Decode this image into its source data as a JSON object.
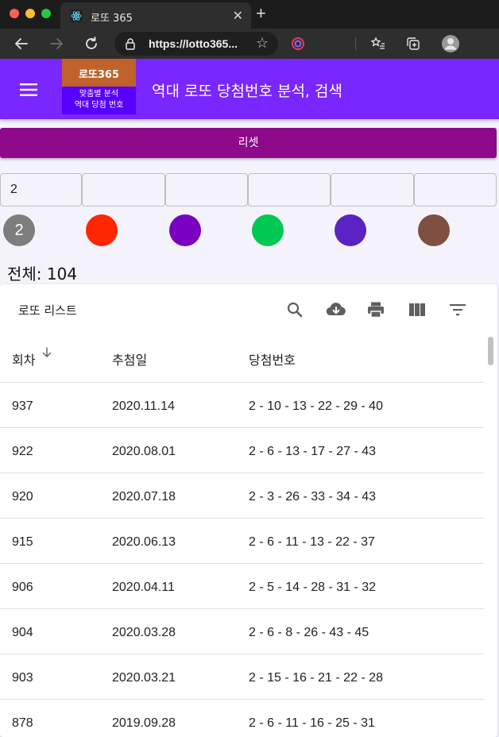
{
  "browser": {
    "tab_title": "로또 365",
    "url": "https://lotto365..."
  },
  "header": {
    "logo_top": "로또365",
    "logo_bottom_line1": "맞춤별 분석",
    "logo_bottom_line2": "역대 당첨 번호",
    "title": "역대 로또 당첨번호 분석, 검색"
  },
  "reset_label": "리셋",
  "inputs": [
    {
      "value": "2"
    },
    {
      "value": ""
    },
    {
      "value": ""
    },
    {
      "value": ""
    },
    {
      "value": ""
    },
    {
      "value": ""
    }
  ],
  "balls": [
    {
      "label": "2",
      "color": "#7d7d7d"
    },
    {
      "label": "",
      "color": "#ff2600"
    },
    {
      "label": "",
      "color": "#7a00c2"
    },
    {
      "label": "",
      "color": "#00c853"
    },
    {
      "label": "",
      "color": "#5a22c3"
    },
    {
      "label": "",
      "color": "#7f4f42"
    }
  ],
  "total_text": "전체: 104",
  "table": {
    "title": "로또 리스트",
    "columns": [
      "회차",
      "추첨일",
      "당첨번호"
    ],
    "icons": [
      "search-icon",
      "cloud-download-icon",
      "print-icon",
      "view-columns-icon",
      "filter-list-icon"
    ],
    "rows": [
      {
        "round": "937",
        "date": "2020.11.14",
        "numbers": "2 - 10 - 13 - 22 - 29 - 40"
      },
      {
        "round": "922",
        "date": "2020.08.01",
        "numbers": "2 - 6 - 13 - 17 - 27 - 43"
      },
      {
        "round": "920",
        "date": "2020.07.18",
        "numbers": "2 - 3 - 26 - 33 - 34 - 43"
      },
      {
        "round": "915",
        "date": "2020.06.13",
        "numbers": "2 - 6 - 11 - 13 - 22 - 37"
      },
      {
        "round": "906",
        "date": "2020.04.11",
        "numbers": "2 - 5 - 14 - 28 - 31 - 32"
      },
      {
        "round": "904",
        "date": "2020.03.28",
        "numbers": "2 - 6 - 8 - 26 - 43 - 45"
      },
      {
        "round": "903",
        "date": "2020.03.21",
        "numbers": "2 - 15 - 16 - 21 - 22 - 28"
      },
      {
        "round": "878",
        "date": "2019.09.28",
        "numbers": "2 - 6 - 11 - 16 - 25 - 31"
      }
    ]
  }
}
